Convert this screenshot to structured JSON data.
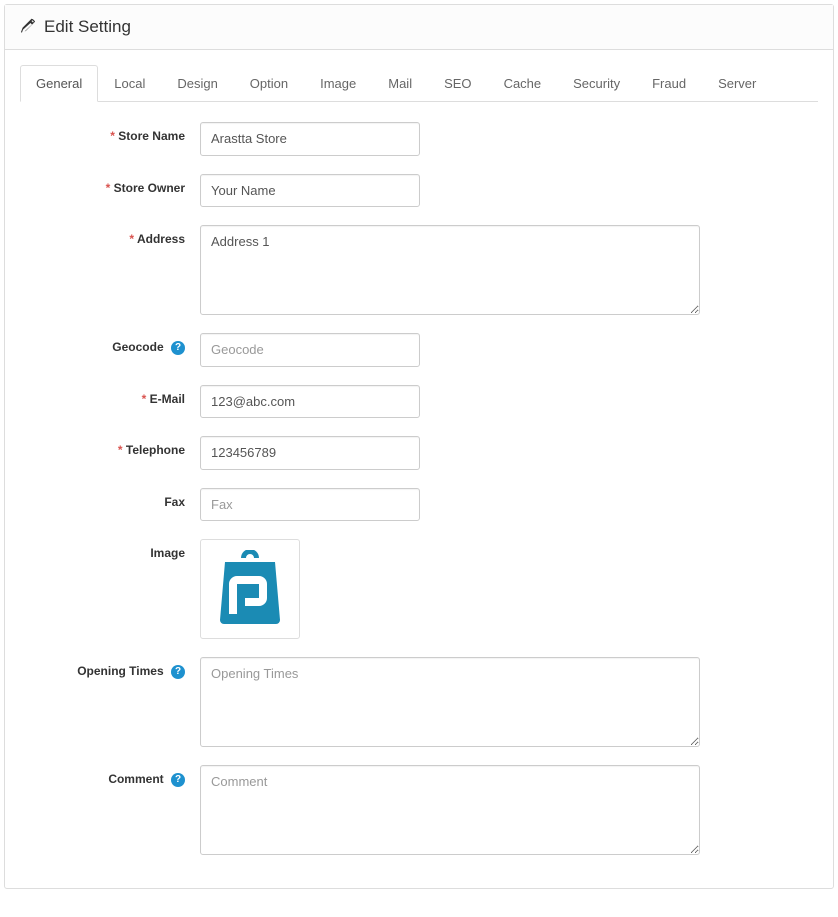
{
  "header": {
    "title": "Edit Setting"
  },
  "tabs": [
    {
      "label": "General",
      "active": true
    },
    {
      "label": "Local"
    },
    {
      "label": "Design"
    },
    {
      "label": "Option"
    },
    {
      "label": "Image"
    },
    {
      "label": "Mail"
    },
    {
      "label": "SEO"
    },
    {
      "label": "Cache"
    },
    {
      "label": "Security"
    },
    {
      "label": "Fraud"
    },
    {
      "label": "Server"
    }
  ],
  "form": {
    "store_name": {
      "label": "Store Name",
      "value": "Arastta Store"
    },
    "store_owner": {
      "label": "Store Owner",
      "value": "Your Name"
    },
    "address": {
      "label": "Address",
      "value": "Address 1"
    },
    "geocode": {
      "label": "Geocode",
      "placeholder": "Geocode",
      "value": ""
    },
    "email": {
      "label": "E-Mail",
      "value": "123@abc.com"
    },
    "telephone": {
      "label": "Telephone",
      "value": "123456789"
    },
    "fax": {
      "label": "Fax",
      "placeholder": "Fax",
      "value": ""
    },
    "image": {
      "label": "Image"
    },
    "opening_times": {
      "label": "Opening Times",
      "placeholder": "Opening Times",
      "value": ""
    },
    "comment": {
      "label": "Comment",
      "placeholder": "Comment",
      "value": ""
    }
  }
}
